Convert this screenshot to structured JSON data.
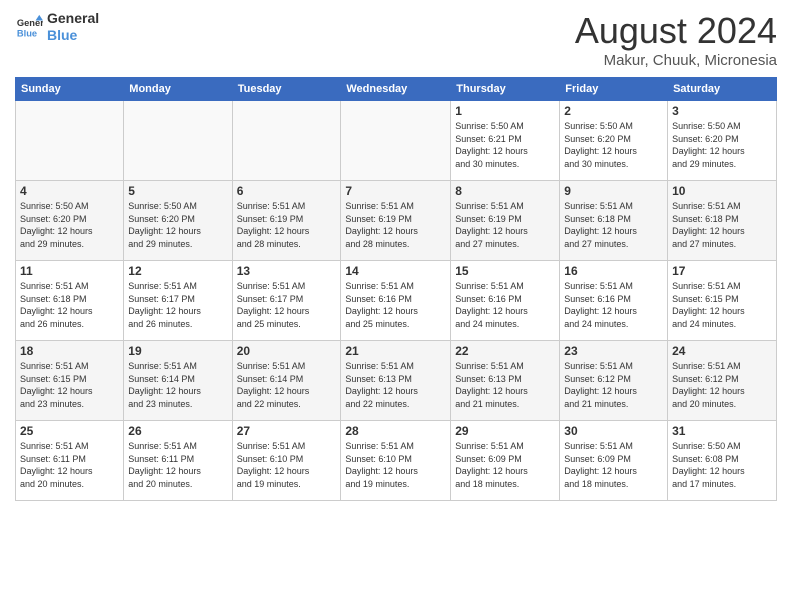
{
  "header": {
    "logo_general": "General",
    "logo_blue": "Blue",
    "month_title": "August 2024",
    "subtitle": "Makur, Chuuk, Micronesia"
  },
  "weekdays": [
    "Sunday",
    "Monday",
    "Tuesday",
    "Wednesday",
    "Thursday",
    "Friday",
    "Saturday"
  ],
  "weeks": [
    [
      {
        "day": "",
        "info": ""
      },
      {
        "day": "",
        "info": ""
      },
      {
        "day": "",
        "info": ""
      },
      {
        "day": "",
        "info": ""
      },
      {
        "day": "1",
        "info": "Sunrise: 5:50 AM\nSunset: 6:21 PM\nDaylight: 12 hours\nand 30 minutes."
      },
      {
        "day": "2",
        "info": "Sunrise: 5:50 AM\nSunset: 6:20 PM\nDaylight: 12 hours\nand 30 minutes."
      },
      {
        "day": "3",
        "info": "Sunrise: 5:50 AM\nSunset: 6:20 PM\nDaylight: 12 hours\nand 29 minutes."
      }
    ],
    [
      {
        "day": "4",
        "info": "Sunrise: 5:50 AM\nSunset: 6:20 PM\nDaylight: 12 hours\nand 29 minutes."
      },
      {
        "day": "5",
        "info": "Sunrise: 5:50 AM\nSunset: 6:20 PM\nDaylight: 12 hours\nand 29 minutes."
      },
      {
        "day": "6",
        "info": "Sunrise: 5:51 AM\nSunset: 6:19 PM\nDaylight: 12 hours\nand 28 minutes."
      },
      {
        "day": "7",
        "info": "Sunrise: 5:51 AM\nSunset: 6:19 PM\nDaylight: 12 hours\nand 28 minutes."
      },
      {
        "day": "8",
        "info": "Sunrise: 5:51 AM\nSunset: 6:19 PM\nDaylight: 12 hours\nand 27 minutes."
      },
      {
        "day": "9",
        "info": "Sunrise: 5:51 AM\nSunset: 6:18 PM\nDaylight: 12 hours\nand 27 minutes."
      },
      {
        "day": "10",
        "info": "Sunrise: 5:51 AM\nSunset: 6:18 PM\nDaylight: 12 hours\nand 27 minutes."
      }
    ],
    [
      {
        "day": "11",
        "info": "Sunrise: 5:51 AM\nSunset: 6:18 PM\nDaylight: 12 hours\nand 26 minutes."
      },
      {
        "day": "12",
        "info": "Sunrise: 5:51 AM\nSunset: 6:17 PM\nDaylight: 12 hours\nand 26 minutes."
      },
      {
        "day": "13",
        "info": "Sunrise: 5:51 AM\nSunset: 6:17 PM\nDaylight: 12 hours\nand 25 minutes."
      },
      {
        "day": "14",
        "info": "Sunrise: 5:51 AM\nSunset: 6:16 PM\nDaylight: 12 hours\nand 25 minutes."
      },
      {
        "day": "15",
        "info": "Sunrise: 5:51 AM\nSunset: 6:16 PM\nDaylight: 12 hours\nand 24 minutes."
      },
      {
        "day": "16",
        "info": "Sunrise: 5:51 AM\nSunset: 6:16 PM\nDaylight: 12 hours\nand 24 minutes."
      },
      {
        "day": "17",
        "info": "Sunrise: 5:51 AM\nSunset: 6:15 PM\nDaylight: 12 hours\nand 24 minutes."
      }
    ],
    [
      {
        "day": "18",
        "info": "Sunrise: 5:51 AM\nSunset: 6:15 PM\nDaylight: 12 hours\nand 23 minutes."
      },
      {
        "day": "19",
        "info": "Sunrise: 5:51 AM\nSunset: 6:14 PM\nDaylight: 12 hours\nand 23 minutes."
      },
      {
        "day": "20",
        "info": "Sunrise: 5:51 AM\nSunset: 6:14 PM\nDaylight: 12 hours\nand 22 minutes."
      },
      {
        "day": "21",
        "info": "Sunrise: 5:51 AM\nSunset: 6:13 PM\nDaylight: 12 hours\nand 22 minutes."
      },
      {
        "day": "22",
        "info": "Sunrise: 5:51 AM\nSunset: 6:13 PM\nDaylight: 12 hours\nand 21 minutes."
      },
      {
        "day": "23",
        "info": "Sunrise: 5:51 AM\nSunset: 6:12 PM\nDaylight: 12 hours\nand 21 minutes."
      },
      {
        "day": "24",
        "info": "Sunrise: 5:51 AM\nSunset: 6:12 PM\nDaylight: 12 hours\nand 20 minutes."
      }
    ],
    [
      {
        "day": "25",
        "info": "Sunrise: 5:51 AM\nSunset: 6:11 PM\nDaylight: 12 hours\nand 20 minutes."
      },
      {
        "day": "26",
        "info": "Sunrise: 5:51 AM\nSunset: 6:11 PM\nDaylight: 12 hours\nand 20 minutes."
      },
      {
        "day": "27",
        "info": "Sunrise: 5:51 AM\nSunset: 6:10 PM\nDaylight: 12 hours\nand 19 minutes."
      },
      {
        "day": "28",
        "info": "Sunrise: 5:51 AM\nSunset: 6:10 PM\nDaylight: 12 hours\nand 19 minutes."
      },
      {
        "day": "29",
        "info": "Sunrise: 5:51 AM\nSunset: 6:09 PM\nDaylight: 12 hours\nand 18 minutes."
      },
      {
        "day": "30",
        "info": "Sunrise: 5:51 AM\nSunset: 6:09 PM\nDaylight: 12 hours\nand 18 minutes."
      },
      {
        "day": "31",
        "info": "Sunrise: 5:50 AM\nSunset: 6:08 PM\nDaylight: 12 hours\nand 17 minutes."
      }
    ]
  ]
}
